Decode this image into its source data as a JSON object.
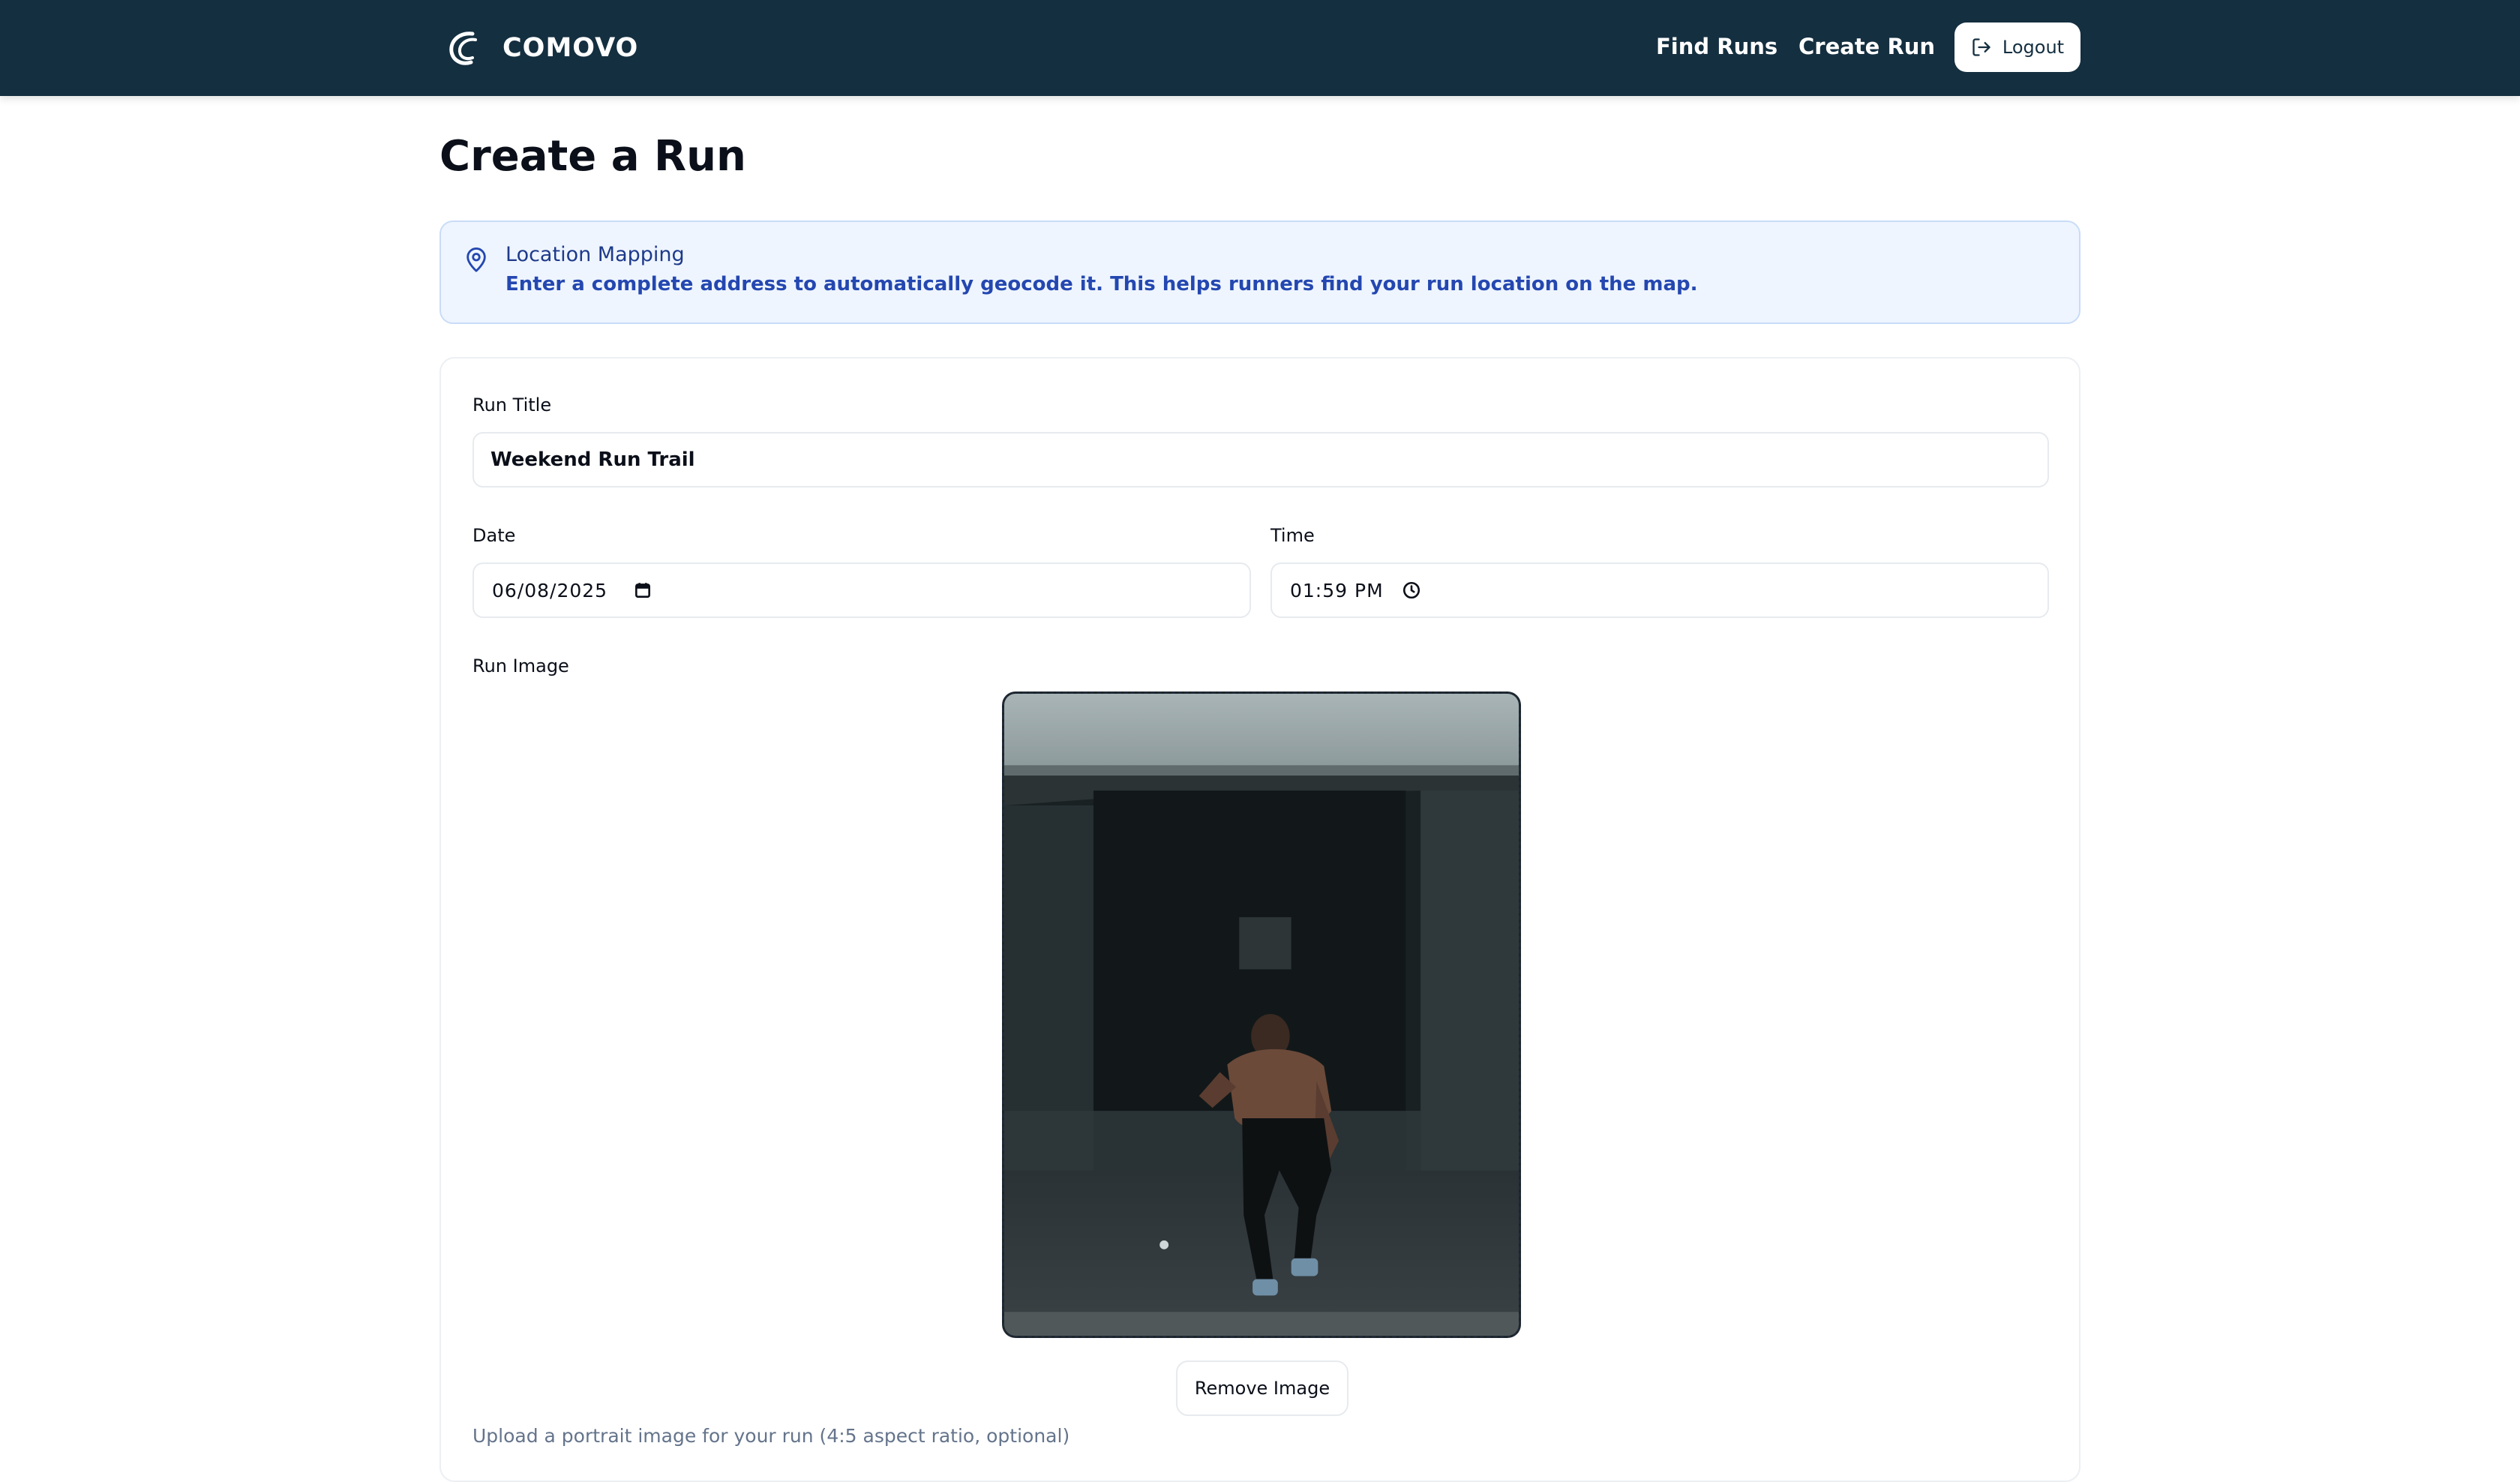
{
  "colors": {
    "header_bg": "#142f40",
    "banner_bg": "#eef5ff",
    "banner_text": "#2447b0",
    "banner_title": "#1e3a8a"
  },
  "header": {
    "brand": "COMOVO",
    "nav": [
      {
        "label": "Find Runs"
      },
      {
        "label": "Create Run"
      }
    ],
    "logout_label": "Logout"
  },
  "page": {
    "title": "Create a Run"
  },
  "banner": {
    "icon": "map-pin-icon",
    "title": "Location Mapping",
    "text": "Enter a complete address to automatically geocode it. This helps runners find your run location on the map."
  },
  "form": {
    "run_title": {
      "label": "Run Title",
      "value": "Weekend Run Trail"
    },
    "date": {
      "label": "Date",
      "value": "06/08/2025",
      "icon": "calendar-icon"
    },
    "time": {
      "label": "Time",
      "value": "01:59 PM",
      "icon": "clock-icon"
    },
    "image": {
      "label": "Run Image",
      "alt": "Runner in starting stance under a concrete overpass",
      "remove_label": "Remove Image",
      "help": "Upload a portrait image for your run (4:5 aspect ratio, optional)"
    }
  }
}
